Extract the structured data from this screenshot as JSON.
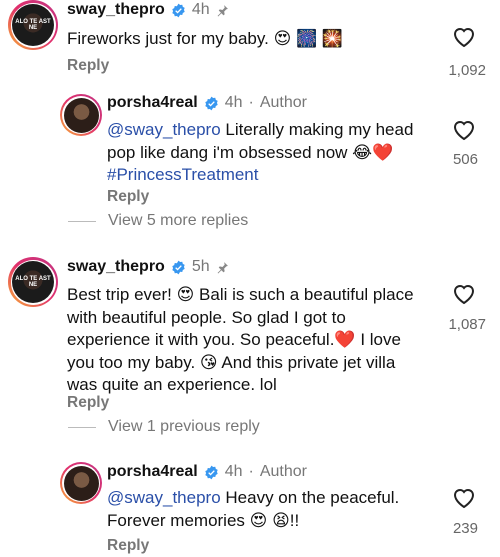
{
  "comments": [
    {
      "username": "sway_thepro",
      "time": "4h",
      "text": "Fireworks just for my baby. 😍 🎆 🎇",
      "reply_label": "Reply",
      "likes": "1,092",
      "avatar_text": "ALO TE AST NE"
    },
    {
      "username": "porsha4real",
      "time": "4h",
      "author_label": "Author",
      "mention": "@sway_thepro",
      "text": "Literally making my head pop like dang i'm obsessed now 😂❤️",
      "hashtag": "#PrincessTreatment",
      "reply_label": "Reply",
      "likes": "506"
    },
    {
      "username": "sway_thepro",
      "time": "5h",
      "text": "Best trip ever! 😍 Bali is such a beautiful place with beautiful people. So glad I got to experience it with you. So peaceful.❤️ I love you too my baby. 😘 And this private jet villa was quite an experience. lol",
      "reply_label": "Reply",
      "likes": "1,087",
      "avatar_text": "ALO TE AST NE"
    },
    {
      "username": "porsha4real",
      "time": "4h",
      "author_label": "Author",
      "mention": "@sway_thepro",
      "text": "Heavy on the peaceful. Forever memories 😍 😫!!",
      "reply_label": "Reply",
      "likes": "239"
    }
  ],
  "view_more_replies": "View 5 more replies",
  "view_previous_reply": "View 1 previous reply",
  "colors": {
    "link": "#2a4fa8",
    "verified": "#3897f0",
    "muted": "#777777"
  }
}
